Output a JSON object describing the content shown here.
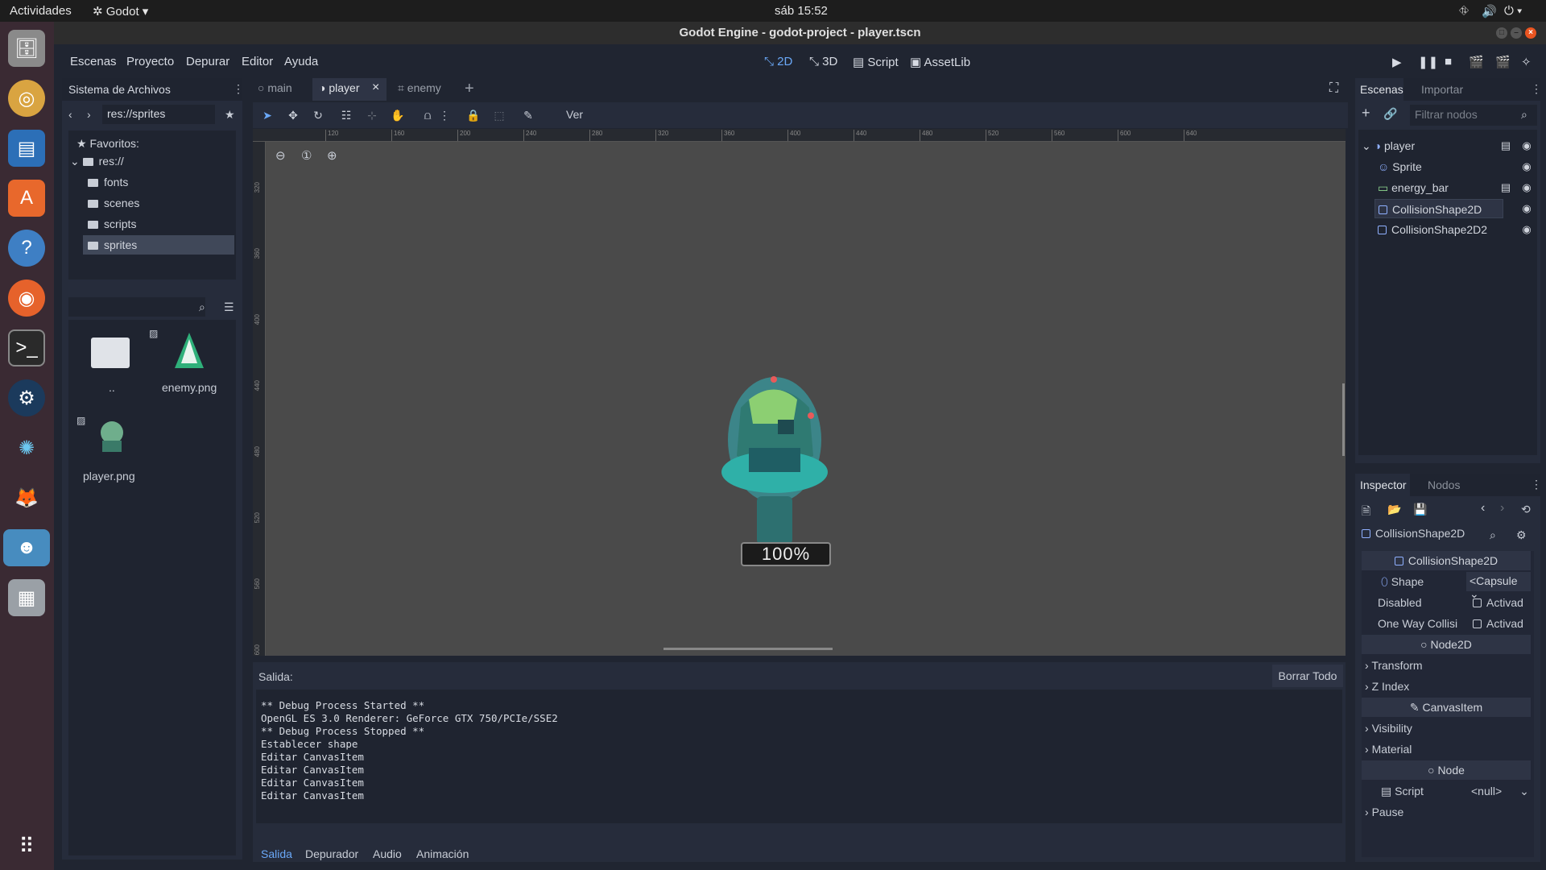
{
  "topbar": {
    "activities": "Actividades",
    "app": "Godot",
    "clock": "sáb 15:52"
  },
  "window": {
    "title": "Godot Engine - godot-project - player.tscn"
  },
  "menu": {
    "items": [
      "Escenas",
      "Proyecto",
      "Depurar",
      "Editor",
      "Ayuda"
    ]
  },
  "workspaces": {
    "w2d": "2D",
    "w3d": "3D",
    "script": "Script",
    "assetlib": "AssetLib"
  },
  "filesystem": {
    "title": "Sistema de Archivos",
    "path": "res://sprites",
    "favorites": "Favoritos:",
    "root": "res://",
    "folders": [
      "fonts",
      "scenes",
      "scripts",
      "sprites"
    ],
    "files": [
      "..",
      "enemy.png",
      "player.png"
    ]
  },
  "scene_tabs": [
    "main",
    "player",
    "enemy"
  ],
  "toolbar": {
    "view": "Ver"
  },
  "ruler_ticks": [
    "120",
    "160",
    "200",
    "240",
    "280",
    "320",
    "360",
    "400",
    "440",
    "480",
    "520",
    "560",
    "600",
    "640"
  ],
  "ruler_v_ticks": [
    "320",
    "360",
    "400",
    "440",
    "480",
    "520",
    "560",
    "600"
  ],
  "viewport": {
    "energy_label": "100%"
  },
  "output": {
    "title": "Salida:",
    "clear": "Borrar Todo",
    "lines": [
      "** Debug Process Started **",
      "OpenGL ES 3.0 Renderer: GeForce GTX 750/PCIe/SSE2",
      "** Debug Process Stopped **",
      "Establecer shape",
      "Editar CanvasItem",
      "Editar CanvasItem",
      "Editar CanvasItem",
      "Editar CanvasItem"
    ],
    "tabs": [
      "Salida",
      "Depurador",
      "Audio",
      "Animación"
    ]
  },
  "scene_panel": {
    "tabs": [
      "Escenas",
      "Importar"
    ],
    "filter_placeholder": "Filtrar nodos",
    "nodes": [
      "player",
      "Sprite",
      "energy_bar",
      "CollisionShape2D",
      "CollisionShape2D2"
    ]
  },
  "inspector": {
    "tabs": [
      "Inspector",
      "Nodos"
    ],
    "object": "CollisionShape2D",
    "section_collision": "CollisionShape2D",
    "shape_label": "Shape",
    "shape_value": "<Capsule",
    "disabled_label": "Disabled",
    "disabled_value": "Activad",
    "oneway_label": "One Way Collisi",
    "oneway_value": "Activad",
    "section_node2d": "Node2D",
    "transform": "Transform",
    "zindex": "Z Index",
    "section_canvas": "CanvasItem",
    "visibility": "Visibility",
    "material": "Material",
    "section_node": "Node",
    "script_label": "Script",
    "script_value": "<null>",
    "pause": "Pause"
  },
  "colors": {
    "accent": "#6aa8f7",
    "bg": "#202531",
    "panel": "#262c3b",
    "viewport": "#4a4a4a"
  }
}
